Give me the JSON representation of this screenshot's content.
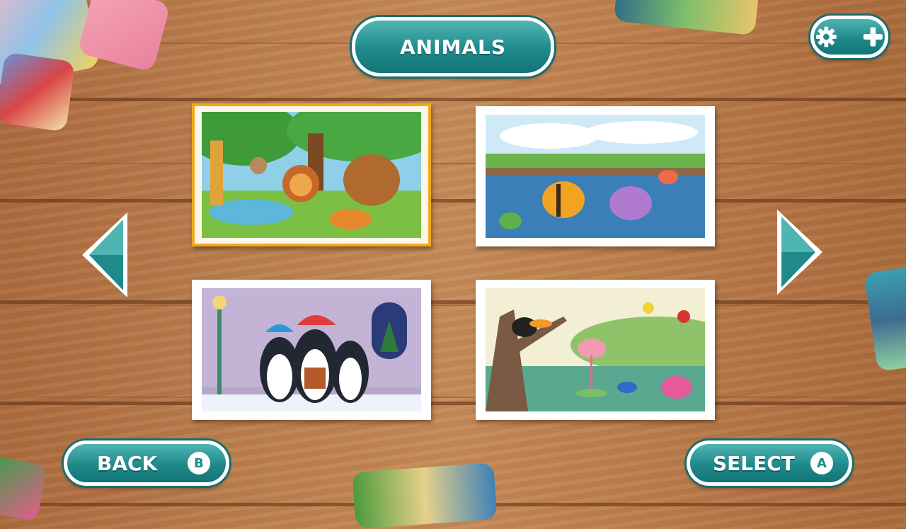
{
  "header": {
    "title": "ANIMALS"
  },
  "settings": {
    "gear_icon": "gear-icon",
    "plus_icon": "plus-icon"
  },
  "navigation": {
    "left_icon": "chevron-left-icon",
    "right_icon": "chevron-right-icon"
  },
  "footer": {
    "back_label": "BACK",
    "back_badge": "B",
    "select_label": "SELECT",
    "select_badge": "A"
  },
  "puzzles": [
    {
      "id": "jungle",
      "selected": true
    },
    {
      "id": "pond",
      "selected": false
    },
    {
      "id": "penguins",
      "selected": false
    },
    {
      "id": "birds",
      "selected": false
    }
  ],
  "colors": {
    "button_teal": "#1f8a8b",
    "selection_border": "#f0a91c",
    "wood": "#b97d4e"
  }
}
